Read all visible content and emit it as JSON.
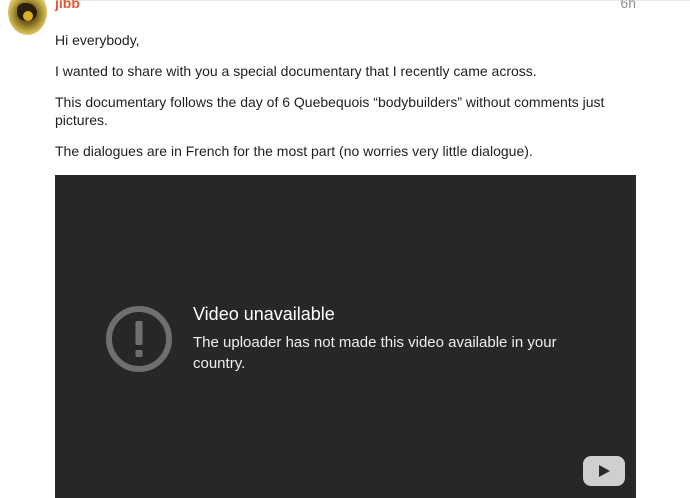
{
  "post": {
    "username": "jibb",
    "date": "6h",
    "paragraphs": [
      "Hi everybody,",
      "I wanted to share with you a special documentary that I recently came across.",
      "This documentary follows the day of 6 Quebequois “bodybuilders” without comments just pictures.",
      "The dialogues are in French for the most part (no worries very little dialogue)."
    ]
  },
  "video": {
    "title": "Video unavailable",
    "message": "The uploader has not made this video available in your country.",
    "icons": {
      "alert": "alert-circle-icon",
      "play": "youtube-play-icon"
    }
  },
  "colors": {
    "username": "#e45735",
    "date": "#919191",
    "text": "#222222",
    "video_bg": "#272727"
  }
}
